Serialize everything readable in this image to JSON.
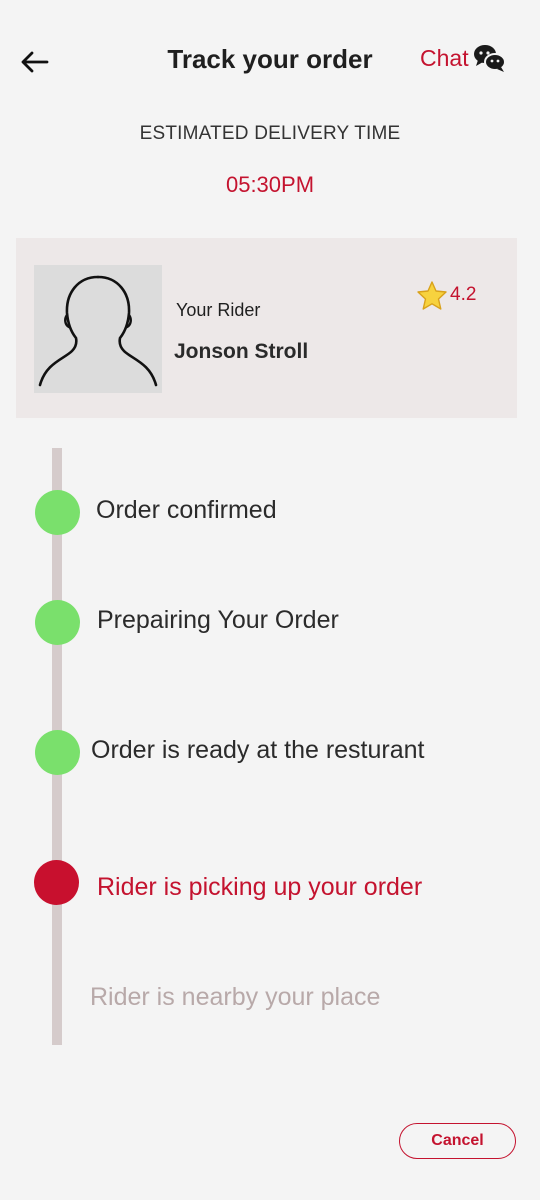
{
  "header": {
    "title": "Track your order",
    "chat_label": "Chat",
    "back_icon": "arrow-left-icon",
    "chat_icon": "chat-bubbles-icon"
  },
  "eta": {
    "label": "ESTIMATED DELIVERY TIME",
    "time": "05:30PM"
  },
  "rider": {
    "subtitle": "Your Rider",
    "name": "Jonson Stroll",
    "rating": "4.2",
    "avatar_icon": "user-silhouette-icon",
    "rating_icon": "star-icon"
  },
  "steps": [
    {
      "label": "Order confirmed",
      "status": "done"
    },
    {
      "label": "Prepairing Your Order",
      "status": "done"
    },
    {
      "label": "Order is ready at the resturant",
      "status": "done"
    },
    {
      "label": "Rider is picking up your order",
      "status": "active"
    },
    {
      "label": "Rider is nearby your place",
      "status": "pending"
    }
  ],
  "actions": {
    "cancel_label": "Cancel"
  },
  "colors": {
    "accent": "#c4132f",
    "done": "#7ae06c",
    "active": "#c8102e",
    "pending_text": "#b8a9a9",
    "track": "#d5cbcb",
    "card_bg": "#ede8e8"
  }
}
